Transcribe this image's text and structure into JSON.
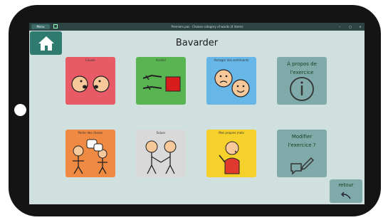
{
  "titlebar": {
    "menu_label": "Menu",
    "window_title": "Premiers pas · Choose category of words (4 items)",
    "controls": [
      "–",
      "▢",
      "×"
    ]
  },
  "home": {
    "icon": "home-icon"
  },
  "page": {
    "title": "Bavarder"
  },
  "tiles": [
    {
      "label": "Causer",
      "color": "#e85a66",
      "icon": "two-faces-talking-icon"
    },
    {
      "label": "Insister",
      "color": "#59b552",
      "icon": "hands-pointing-red-square-icon"
    },
    {
      "label": "Partager des sentiments",
      "color": "#66b6e8",
      "icon": "sad-happy-faces-icon"
    },
    {
      "label": "Parler des choses",
      "color": "#f08a43",
      "icon": "people-discussing-icon"
    },
    {
      "label": "Saluer",
      "color": "#d9d9d9",
      "icon": "people-shaking-hands-icon"
    },
    {
      "label": "Mes propres mots",
      "color": "#f6d12c",
      "icon": "person-speaking-icon"
    }
  ],
  "side": {
    "about_label": "À propos de l'exercice",
    "about_icon": "info-icon",
    "edit_label": "Modifier l'exercice ?",
    "edit_icon": "edit-speech-icon"
  },
  "back": {
    "label": "retour",
    "icon": "return-arrow-icon"
  }
}
